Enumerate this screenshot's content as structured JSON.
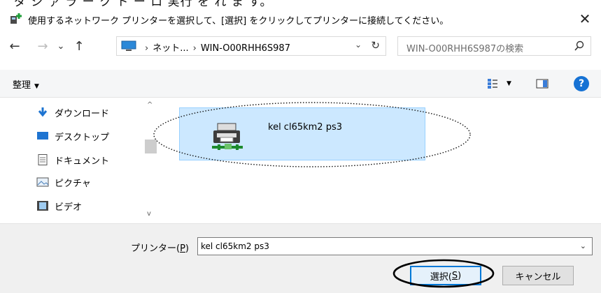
{
  "top_strip_text": "ダ ジ ァ ラ ー ク ト ー ロ 実行 を れ ま す。",
  "window": {
    "title": "使用するネットワーク プリンターを選択して、[選択] をクリックしてプリンターに接続してください。",
    "close_glyph": "✕"
  },
  "address": {
    "back": "←",
    "forward": "→",
    "recent": "⌄",
    "up": "↑",
    "crumb_sep": "›",
    "crumbs": [
      "ネット...",
      "WIN-O00RHH6S987"
    ],
    "dropdown": "⌄",
    "refresh": "↻"
  },
  "search": {
    "placeholder": "WIN-O00RHH6S987の検索"
  },
  "toolbar": {
    "organize_label": "整理",
    "organize_caret": "▼",
    "view_caret": "▼",
    "help": "?"
  },
  "nav_pane": {
    "items": [
      {
        "label": "ダウンロード",
        "icon": "download-arrow-icon"
      },
      {
        "label": "デスクトップ",
        "icon": "desktop-icon"
      },
      {
        "label": "ドキュメント",
        "icon": "document-icon"
      },
      {
        "label": "ピクチャ",
        "icon": "picture-icon"
      },
      {
        "label": "ビデオ",
        "icon": "video-icon"
      }
    ],
    "scroll_up": "^",
    "scroll_down": "v"
  },
  "content": {
    "printers": [
      {
        "name": "kel cl65km2 ps3",
        "selected": true
      }
    ]
  },
  "bottom": {
    "printer_label_prefix": "プリンター(",
    "printer_label_key": "P",
    "printer_label_suffix": ")",
    "printer_value": "kel cl65km2 ps3",
    "field_dropdown": "⌄",
    "select_prefix": "選択(",
    "select_key": "S",
    "select_suffix": ")",
    "cancel_label": "キャンセル"
  },
  "colors": {
    "selection_fill": "#cce8ff",
    "selection_border": "#99d1ff",
    "accent": "#0078d7",
    "help_blue": "#1672d4"
  }
}
